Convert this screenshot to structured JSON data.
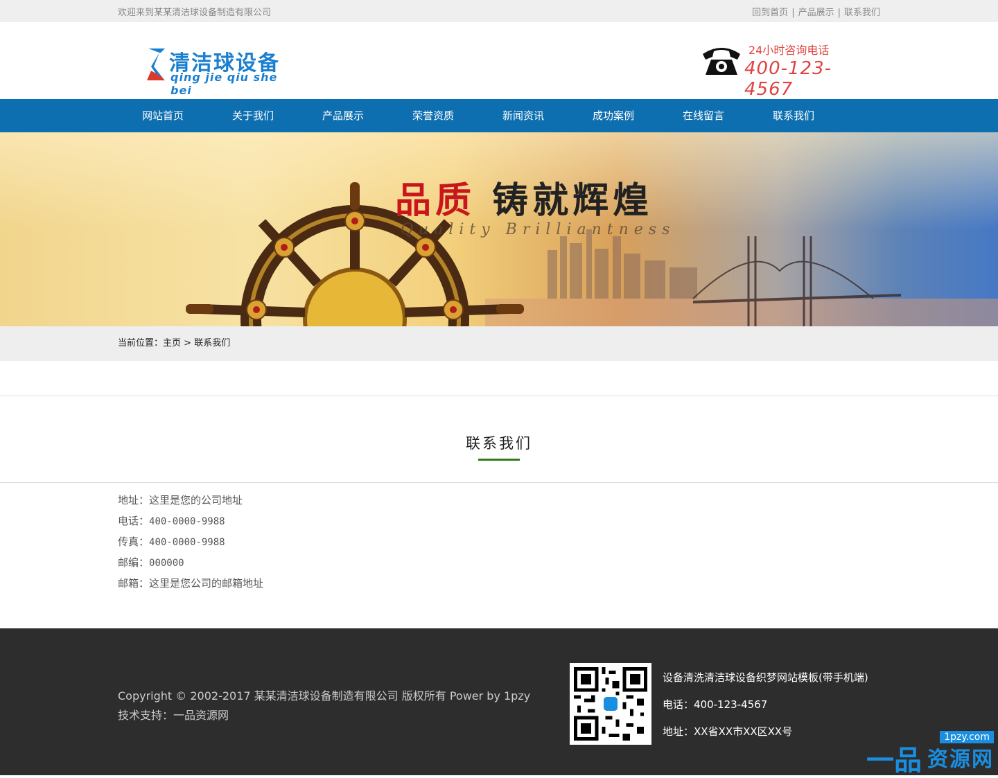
{
  "topbar": {
    "welcome": "欢迎来到某某清洁球设备制造有限公司",
    "links": [
      "回到首页",
      "产品展示",
      "联系我们"
    ],
    "sep": "|"
  },
  "header": {
    "logo_cn": "清洁球设备",
    "logo_py": "qing jie qiu she bei",
    "hotline_label": "24小时咨询电话",
    "hotline_number": "400-123-4567",
    "accent": "#e0433f",
    "logo_color": "#1a7fd0"
  },
  "nav": {
    "bg": "#0d6fb0",
    "items": [
      "网站首页",
      "关于我们",
      "产品展示",
      "荣誉资质",
      "新闻资讯",
      "成功案例",
      "在线留言",
      "联系我们"
    ]
  },
  "banner": {
    "title_red": "品质",
    "title_black": "铸就辉煌",
    "subtitle": "Quality Brilliantness"
  },
  "breadcrumb": {
    "label": "当前位置：",
    "home": "主页",
    "sep": ">",
    "current": "联系我们"
  },
  "main": {
    "title": "联系我们",
    "contact": [
      {
        "label": "地址：",
        "value": "这里是您的公司地址"
      },
      {
        "label": "电话：",
        "value": "400-0000-9988"
      },
      {
        "label": "传真：",
        "value": "400-0000-9988"
      },
      {
        "label": "邮编：",
        "value": "000000"
      },
      {
        "label": "邮箱：",
        "value": "这里是您公司的邮箱地址"
      }
    ]
  },
  "footer": {
    "copyright": "Copyright © 2002-2017 某某清洁球设备制造有限公司 版权所有 Power by 1pzy",
    "support": "技术支持：一品资源网",
    "site_name": "设备清洗清洁球设备织梦网站模板(带手机端)",
    "phone": "电话：400-123-4567",
    "address": "地址：XX省XX市XX区XX号"
  },
  "watermark": {
    "url": "1pzy.com",
    "text": "资源网",
    "mark": "一品"
  }
}
